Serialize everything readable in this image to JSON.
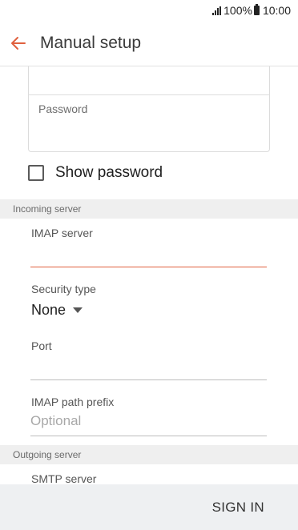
{
  "status_bar": {
    "battery": "100%",
    "time": "10:00"
  },
  "app_bar": {
    "title": "Manual setup"
  },
  "account": {
    "password_label": "Password",
    "password_value": ""
  },
  "show_password": {
    "label": "Show password",
    "checked": false
  },
  "incoming": {
    "header": "Incoming server",
    "imap_server_label": "IMAP server",
    "imap_server_value": "",
    "security_type_label": "Security type",
    "security_type_value": "None",
    "port_label": "Port",
    "port_value": "",
    "imap_path_prefix_label": "IMAP path prefix",
    "imap_path_prefix_placeholder": "Optional"
  },
  "outgoing": {
    "header": "Outgoing server",
    "smtp_server_label": "SMTP server"
  },
  "footer": {
    "sign_in_label": "SIGN IN"
  },
  "colors": {
    "accent": "#e0603e",
    "section_bg": "#efefef",
    "bottom_bar_bg": "#eef0f2"
  }
}
